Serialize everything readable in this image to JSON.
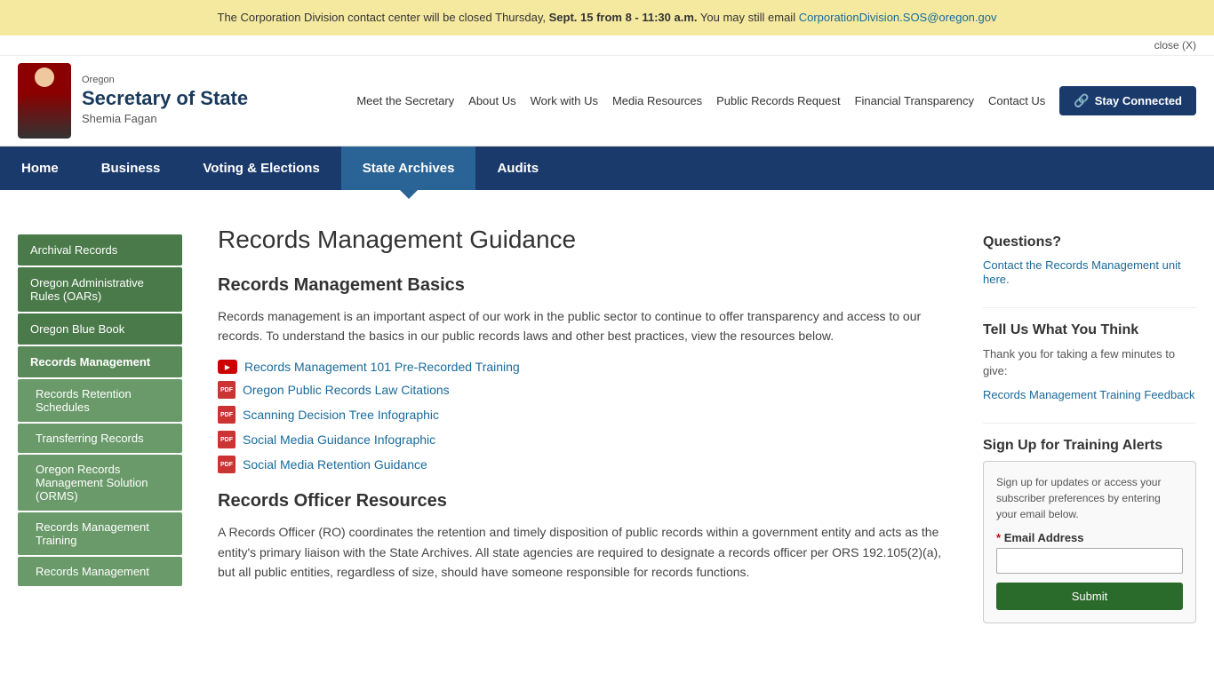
{
  "alert": {
    "text_before": "The Corporation Division contact center will be closed Thursday,",
    "bold_text": "Sept. 15 from 8 - 11:30 a.m.",
    "text_after": "You may still email",
    "email": "CorporationDivision.SOS@oregon.gov",
    "close_label": "close (X)"
  },
  "header": {
    "oregon_label": "Oregon",
    "sos_label": "Secretary of State",
    "name_label": "Shemia Fagan",
    "top_nav": [
      {
        "label": "Meet the Secretary",
        "href": "#"
      },
      {
        "label": "About Us",
        "href": "#"
      },
      {
        "label": "Work with Us",
        "href": "#"
      },
      {
        "label": "Media Resources",
        "href": "#"
      },
      {
        "label": "Public Records Request",
        "href": "#"
      },
      {
        "label": "Financial Transparency",
        "href": "#"
      },
      {
        "label": "Contact Us",
        "href": "#"
      }
    ],
    "stay_connected_label": "Stay Connected"
  },
  "main_nav": [
    {
      "label": "Home",
      "href": "#",
      "active": false
    },
    {
      "label": "Business",
      "href": "#",
      "active": false
    },
    {
      "label": "Voting & Elections",
      "href": "#",
      "active": false
    },
    {
      "label": "State Archives",
      "href": "#",
      "active": true
    },
    {
      "label": "Audits",
      "href": "#",
      "active": false
    }
  ],
  "sidebar": {
    "items": [
      {
        "label": "Archival Records",
        "href": "#",
        "active": false,
        "sub": false
      },
      {
        "label": "Oregon Administrative Rules (OARs)",
        "href": "#",
        "active": false,
        "sub": false
      },
      {
        "label": "Oregon Blue Book",
        "href": "#",
        "active": false,
        "sub": false
      },
      {
        "label": "Records Management",
        "href": "#",
        "active": true,
        "sub": false
      },
      {
        "label": "Records Retention Schedules",
        "href": "#",
        "active": false,
        "sub": true
      },
      {
        "label": "Transferring Records",
        "href": "#",
        "active": false,
        "sub": true
      },
      {
        "label": "Oregon Records Management Solution (ORMS)",
        "href": "#",
        "active": false,
        "sub": true
      },
      {
        "label": "Records Management Training",
        "href": "#",
        "active": false,
        "sub": true
      },
      {
        "label": "Records Management",
        "href": "#",
        "active": false,
        "sub": true
      }
    ]
  },
  "page": {
    "title": "Records Management Guidance",
    "section1": {
      "title": "Records Management Basics",
      "body": "Records management is an important aspect of our work in the public sector to continue to offer transparency and access to our records. To understand the basics in our public records laws and other best practices, view the resources below.",
      "links": [
        {
          "label": "Records Management 101 Pre-Recorded Training",
          "href": "#",
          "icon": "youtube"
        },
        {
          "label": "Oregon Public Records Law Citations",
          "href": "#",
          "icon": "pdf"
        },
        {
          "label": "Scanning Decision Tree Infographic",
          "href": "#",
          "icon": "pdf"
        },
        {
          "label": "Social Media Guidance Infographic",
          "href": "#",
          "icon": "pdf"
        },
        {
          "label": "Social Media Retention Guidance",
          "href": "#",
          "icon": "pdf"
        }
      ]
    },
    "section2": {
      "title": "Records Officer Resources",
      "body": "A Records Officer (RO) coordinates the retention and timely disposition of public records within a government entity and acts as the entity's primary liaison with the State Archives. All state agencies are required to designate a records officer per ORS 192.105(2)(a), but all public entities, regardless of size, should have someone responsible for records functions."
    }
  },
  "right_sidebar": {
    "questions": {
      "title": "Questions?",
      "link_label": "Contact the Records Management unit here.",
      "link_href": "#"
    },
    "feedback": {
      "title": "Tell Us What You Think",
      "body": "Thank you for taking a few minutes to give:",
      "link_label": "Records Management Training Feedback",
      "link_href": "#"
    },
    "signup": {
      "title": "Sign Up for Training Alerts",
      "body": "Sign up for updates or access your subscriber preferences by entering your email below.",
      "email_label": "Email Address",
      "email_placeholder": "",
      "submit_label": "Submit"
    }
  }
}
